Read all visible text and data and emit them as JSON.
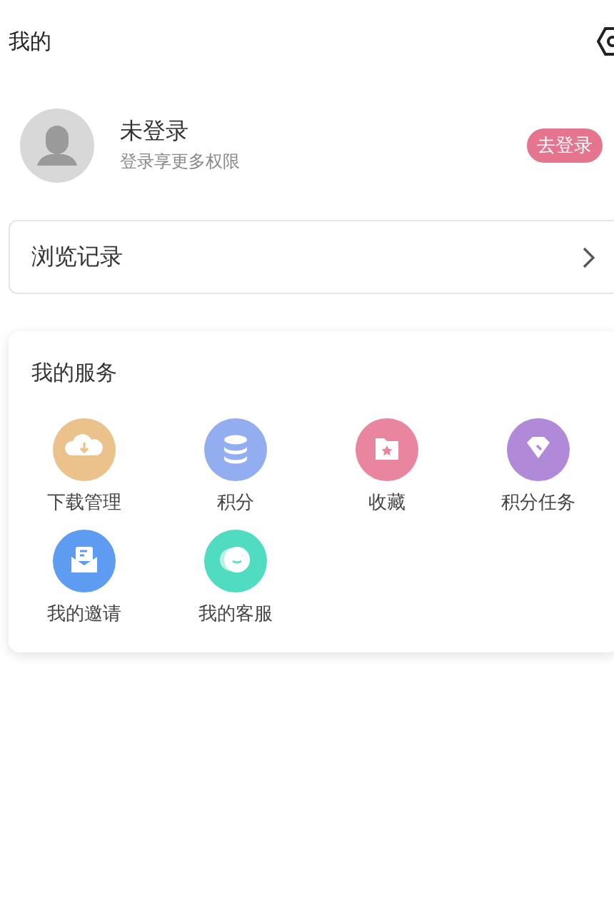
{
  "header": {
    "title": "我的"
  },
  "profile": {
    "name": "未登录",
    "subtitle": "登录享更多权限",
    "login_button": "去登录"
  },
  "history": {
    "label": "浏览记录"
  },
  "services": {
    "title": "我的服务",
    "items": [
      {
        "kind": "download",
        "label": "下载管理",
        "color": "#ebc18c"
      },
      {
        "kind": "coins",
        "label": "积分",
        "color": "#93aef0"
      },
      {
        "kind": "favorite",
        "label": "收藏",
        "color": "#ea85a0"
      },
      {
        "kind": "task",
        "label": "积分任务",
        "color": "#b08ad8"
      },
      {
        "kind": "invite",
        "label": "我的邀请",
        "color": "#5d9cf0"
      },
      {
        "kind": "chat",
        "label": "我的客服",
        "color": "#4fdcc0"
      }
    ]
  }
}
